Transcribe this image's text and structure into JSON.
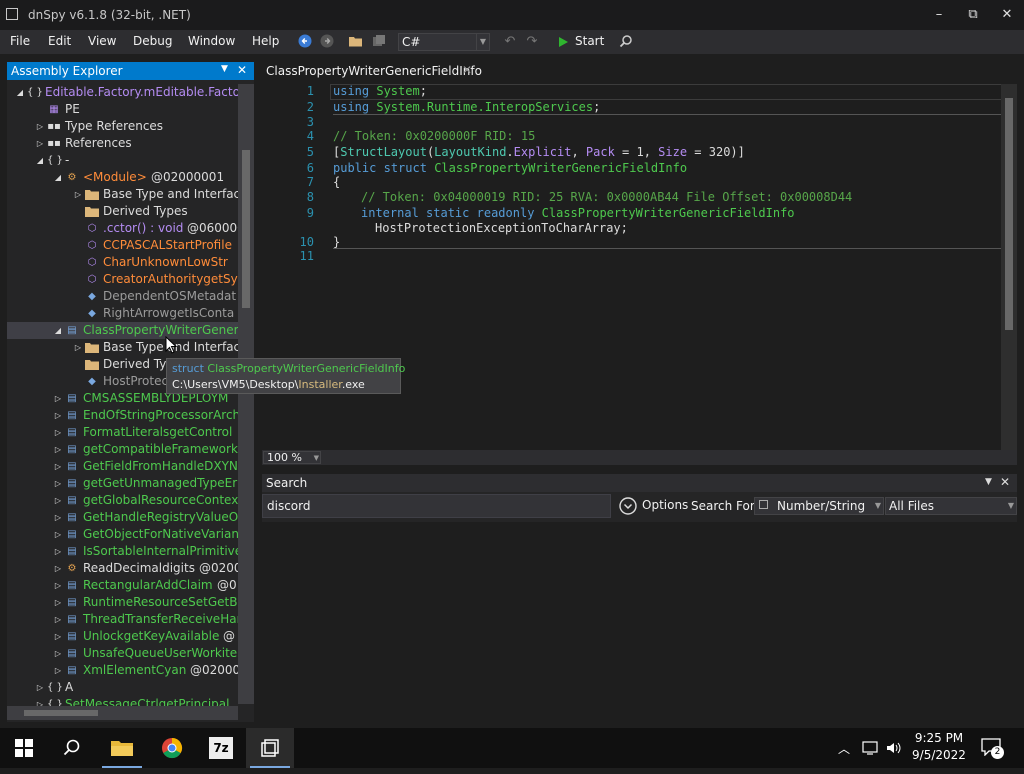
{
  "window": {
    "title": "dnSpy v6.1.8 (32-bit, .NET)",
    "minimize": "–",
    "maximize": "⧉",
    "close": "✕"
  },
  "menu": [
    "File",
    "Edit",
    "View",
    "Debug",
    "Window",
    "Help"
  ],
  "toolbar": {
    "language": "C#",
    "start_label": "Start"
  },
  "assembly_explorer": {
    "title": "Assembly Explorer",
    "nodes": [
      {
        "label": "Editable.Factory.mEditable.Factory",
        "icon": "namespace",
        "color": "#b48cf2"
      },
      {
        "label": "PE",
        "icon": "pe"
      },
      {
        "label": "Type References",
        "icon": "references"
      },
      {
        "label": "References",
        "icon": "references"
      },
      {
        "label": "-",
        "icon": "namespace"
      },
      {
        "label": "<Module>",
        "suffix": "@02000001",
        "icon": "class"
      },
      {
        "label": "Base Type and Interfaces",
        "icon": "folder"
      },
      {
        "label": "Derived Types",
        "icon": "folder"
      },
      {
        "label": ".cctor() : void",
        "suffix": "@060000",
        "icon": "method"
      },
      {
        "label": "CCPASCALStartProfile",
        "icon": "method"
      },
      {
        "label": "CharUnknownLowStr",
        "icon": "method"
      },
      {
        "label": "CreatorAuthoritygetSy",
        "icon": "method"
      },
      {
        "label": "DependentOSMetadat",
        "icon": "field"
      },
      {
        "label": "RightArrowgetIsConta",
        "icon": "field"
      },
      {
        "label": "ClassPropertyWriterGenericFieldInfo",
        "icon": "struct"
      },
      {
        "label": "Base Type and Interfaces",
        "icon": "folder"
      },
      {
        "label": "Derived Types",
        "icon": "folder"
      },
      {
        "label": "HostProtectionExceptionToCharArray",
        "icon": "field"
      },
      {
        "label": "CMSASSEMBLYDEPLOYM",
        "icon": "struct"
      },
      {
        "label": "EndOfStringProcessorArch",
        "icon": "struct"
      },
      {
        "label": "FormatLiteralsgetControl",
        "icon": "struct"
      },
      {
        "label": "getCompatibleFramework",
        "icon": "struct"
      },
      {
        "label": "GetFieldFromHandleDXYN",
        "icon": "struct"
      },
      {
        "label": "getGetUnmanagedTypeEr",
        "icon": "struct"
      },
      {
        "label": "getGlobalResourceContex",
        "icon": "struct"
      },
      {
        "label": "GetHandleRegistryValueO",
        "icon": "struct"
      },
      {
        "label": "GetObjectForNativeVarian",
        "icon": "struct"
      },
      {
        "label": "IsSortableInternalPrimitive",
        "icon": "struct"
      },
      {
        "label": "ReadDecimaldigits",
        "suffix": "@0200",
        "icon": "class"
      },
      {
        "label": "RectangularAddClaim",
        "suffix": "@0",
        "icon": "struct"
      },
      {
        "label": "RuntimeResourceSetGetB",
        "icon": "struct"
      },
      {
        "label": "ThreadTransferReceiveHar",
        "icon": "struct"
      },
      {
        "label": "UnlockgetKeyAvailable",
        "suffix": "@",
        "icon": "struct"
      },
      {
        "label": "UnsafeQueueUserWorkite",
        "icon": "struct"
      },
      {
        "label": "XmlElementCyan",
        "suffix": "@02000",
        "icon": "struct"
      },
      {
        "label": "A",
        "icon": "namespace"
      },
      {
        "label": "SetMessageCtrlgetPrincipal",
        "icon": "namespace"
      }
    ]
  },
  "tab": {
    "title": "ClassPropertyWriterGenericFieldInfo"
  },
  "editor": {
    "line_numbers": [
      "1",
      "2",
      "3",
      "4",
      "5",
      "6",
      "7",
      "8",
      "9",
      "10",
      "11"
    ],
    "l1_using": "using",
    "l1_ns": "System",
    "l1_end": ";",
    "l2_using": "using",
    "l2_ns": "System.Runtime.InteropServices",
    "l2_end": ";",
    "l4_comment": "// Token: 0x0200000F RID: 15",
    "l5_a": "[",
    "l5_attr": "StructLayout",
    "l5_b": "(",
    "l5_enum": "LayoutKind",
    "l5_c": ".",
    "l5_expl": "Explicit",
    "l5_d": ", ",
    "l5_pack": "Pack",
    "l5_e": " = 1, ",
    "l5_size": "Size",
    "l5_f": " = 320)]",
    "l6_public": "public",
    "l6_struct": "struct",
    "l6_name": "ClassPropertyWriterGenericFieldInfo",
    "l7": "{",
    "l8_comment": "// Token: 0x04000019 RID: 25 RVA: 0x0000AB44 File Offset: 0x00008D44",
    "l9_internal": "internal",
    "l9_static": "static",
    "l9_readonly": "readonly",
    "l9_type": "ClassPropertyWriterGenericFieldInfo",
    "l9b": "HostProtectionExceptionToCharArray;",
    "l10": "}"
  },
  "zoom": "100 %",
  "tooltip": {
    "kind": "struct",
    "name": "ClassPropertyWriterGenericFieldInfo",
    "path_prefix": "C:\\Users\\VM5\\Desktop\\",
    "path_file": "Installer",
    "path_ext": ".exe"
  },
  "search": {
    "title": "Search",
    "value": "discord",
    "options_label": "Options",
    "search_for_label": "Search For:",
    "search_for_value": "Number/String",
    "scope_value": "All Files"
  },
  "taskbar": {
    "time": "9:25 PM",
    "date": "9/5/2022",
    "notifications": "2"
  }
}
